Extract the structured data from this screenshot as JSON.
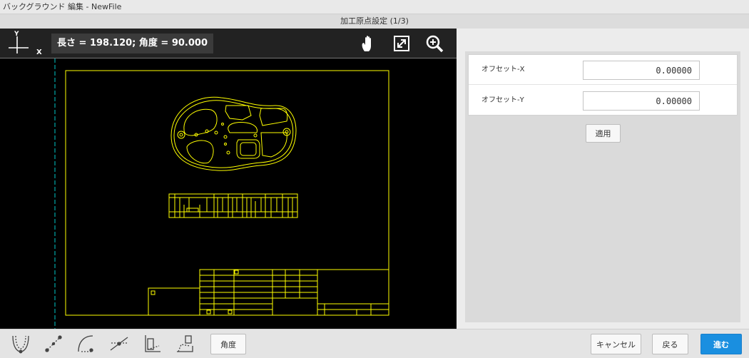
{
  "window": {
    "title": "バックグラウンド 編集 - NewFile"
  },
  "dialog": {
    "title": "加工原点設定 (1/3)"
  },
  "canvas": {
    "axis_y": "Y",
    "axis_x": "X",
    "measurement": "長さ = 198.120; 角度 = 90.000",
    "tools": [
      "hand-icon",
      "fit-screen-icon",
      "zoom-in-icon"
    ],
    "line_color": "#ffff00",
    "guide_color": "#00c8c8"
  },
  "offset": {
    "x_label": "オフセット-X",
    "x_value": "0.00000",
    "y_label": "オフセット-Y",
    "y_value": "0.00000",
    "apply_label": "適用"
  },
  "bottom": {
    "tools": [
      "fit-curve-icon",
      "two-point-line-icon",
      "arc-icon",
      "intersect-line-icon",
      "align-edge-icon",
      "rotate-angle-icon"
    ],
    "angle_label": "角度",
    "cancel_label": "キャンセル",
    "back_label": "戻る",
    "next_label": "進む",
    "accent_color": "#1a8fe0"
  }
}
